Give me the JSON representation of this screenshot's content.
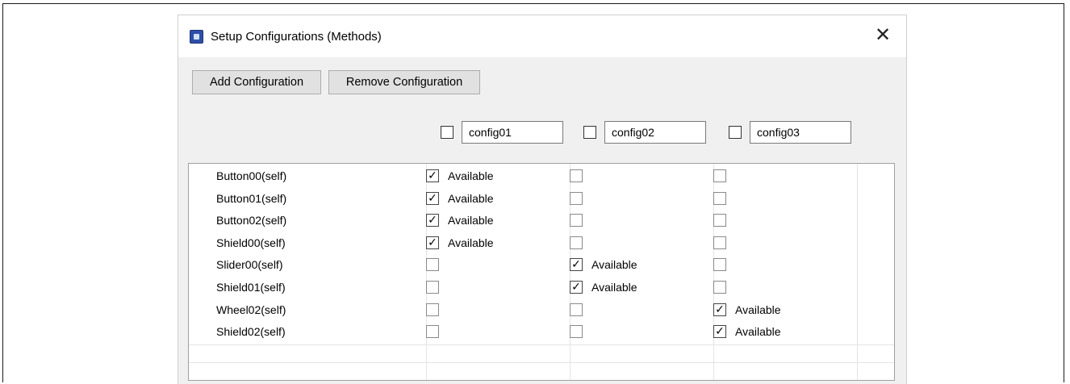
{
  "dialog": {
    "title": "Setup Configurations (Methods)",
    "close_glyph": "✕"
  },
  "toolbar": {
    "add_label": "Add Configuration",
    "remove_label": "Remove Configuration"
  },
  "configs": [
    {
      "name": "config01",
      "selected": false
    },
    {
      "name": "config02",
      "selected": false
    },
    {
      "name": "config03",
      "selected": false
    }
  ],
  "check_glyph": "✓",
  "rows": [
    {
      "label": "Button00(self)",
      "cells": [
        {
          "checked": true,
          "text": "Available"
        },
        {
          "checked": false,
          "text": ""
        },
        {
          "checked": false,
          "text": ""
        }
      ]
    },
    {
      "label": "Button01(self)",
      "cells": [
        {
          "checked": true,
          "text": "Available"
        },
        {
          "checked": false,
          "text": ""
        },
        {
          "checked": false,
          "text": ""
        }
      ]
    },
    {
      "label": "Button02(self)",
      "cells": [
        {
          "checked": true,
          "text": "Available"
        },
        {
          "checked": false,
          "text": ""
        },
        {
          "checked": false,
          "text": ""
        }
      ]
    },
    {
      "label": "Shield00(self)",
      "cells": [
        {
          "checked": true,
          "text": "Available"
        },
        {
          "checked": false,
          "text": ""
        },
        {
          "checked": false,
          "text": ""
        }
      ]
    },
    {
      "label": "Slider00(self)",
      "cells": [
        {
          "checked": false,
          "text": ""
        },
        {
          "checked": true,
          "text": "Available"
        },
        {
          "checked": false,
          "text": ""
        }
      ]
    },
    {
      "label": "Shield01(self)",
      "cells": [
        {
          "checked": false,
          "text": ""
        },
        {
          "checked": true,
          "text": "Available"
        },
        {
          "checked": false,
          "text": ""
        }
      ]
    },
    {
      "label": "Wheel02(self)",
      "cells": [
        {
          "checked": false,
          "text": ""
        },
        {
          "checked": false,
          "text": ""
        },
        {
          "checked": true,
          "text": "Available"
        }
      ]
    },
    {
      "label": "Shield02(self)",
      "cells": [
        {
          "checked": false,
          "text": ""
        },
        {
          "checked": false,
          "text": ""
        },
        {
          "checked": true,
          "text": "Available"
        }
      ]
    }
  ]
}
